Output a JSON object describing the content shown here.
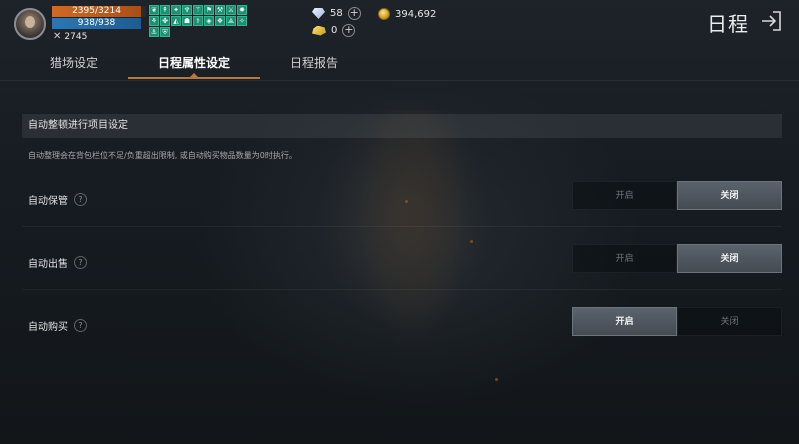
{
  "player": {
    "hp": "2395/3214",
    "hp_fraction": 0.745,
    "mp": "938/938",
    "mp_fraction": 1.0,
    "combat_power": "2745"
  },
  "buffs": [
    "❦",
    "↟",
    "✦",
    "♆",
    "⚚",
    "⚑",
    "⚒",
    "⚔",
    "✹",
    "⚘",
    "✤",
    "◭",
    "☗",
    "⚕",
    "◈",
    "❖",
    "⟁",
    "✧",
    "⚓",
    "⛨"
  ],
  "currency": {
    "diamonds": "58",
    "gold": "394,692",
    "gold_bars": "0"
  },
  "header": {
    "title": "日程"
  },
  "tabs": [
    {
      "label": "猎场设定",
      "active": false
    },
    {
      "label": "日程属性设定",
      "active": true
    },
    {
      "label": "日程报告",
      "active": false
    }
  ],
  "section": {
    "title": "自动整顿进行项目设定",
    "description": "自动整理会在背包栏位不足/负重超出限制, 或自动购买物品数量为0时执行。"
  },
  "settings": [
    {
      "label": "自动保管",
      "on_label": "开启",
      "off_label": "关闭",
      "enabled": false
    },
    {
      "label": "自动出售",
      "on_label": "开启",
      "off_label": "关闭",
      "enabled": false
    },
    {
      "label": "自动购买",
      "on_label": "开启",
      "off_label": "关闭",
      "enabled": true
    }
  ],
  "colors": {
    "accent": "#b6783b",
    "hp_bar": "#d06a24",
    "mp_bar": "#2b77b6",
    "buff": "#1d8f73"
  }
}
